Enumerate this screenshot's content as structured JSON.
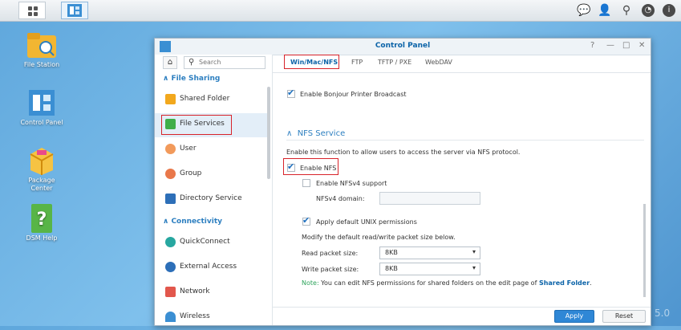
{
  "taskbar": {
    "tray_icons": [
      "chat-icon",
      "user-icon",
      "search-icon",
      "dashboard-icon",
      "info-icon"
    ]
  },
  "desktop": {
    "icons": [
      {
        "label": "File Station"
      },
      {
        "label": "Control Panel"
      },
      {
        "label": "Package\nCenter"
      },
      {
        "label": "DSM Help"
      }
    ]
  },
  "window": {
    "title": "Control Panel",
    "controls": [
      "?",
      "—",
      "□",
      "✕"
    ]
  },
  "sidebar": {
    "search_placeholder": "Search",
    "section1": "File Sharing",
    "section2": "Connectivity",
    "items": [
      {
        "label": "Shared Folder"
      },
      {
        "label": "File Services"
      },
      {
        "label": "User"
      },
      {
        "label": "Group"
      },
      {
        "label": "Directory Service"
      },
      {
        "label": "QuickConnect"
      },
      {
        "label": "External Access"
      },
      {
        "label": "Network"
      },
      {
        "label": "Wireless"
      }
    ]
  },
  "tabs": [
    "Win/Mac/NFS",
    "FTP",
    "TFTP / PXE",
    "WebDAV"
  ],
  "content": {
    "bonjour": "Enable Bonjour Printer Broadcast",
    "nfs_title": "NFS Service",
    "nfs_desc": "Enable this function to allow users to access the server via NFS protocol.",
    "enable_nfs": "Enable NFS",
    "nfsv4": "Enable NFSv4 support",
    "nfsv4_domain_label": "NFSv4 domain:",
    "nfsv4_domain_value": "",
    "unix_perm": "Apply default UNIX permissions",
    "packet_desc": "Modify the default read/write packet size below.",
    "read_label": "Read packet size:",
    "read_value": "8KB",
    "write_label": "Write packet size:",
    "write_value": "8KB",
    "note_prefix": "Note:",
    "note_text": " You can edit NFS permissions for shared folders on the edit page of ",
    "note_link": "Shared Folder",
    "note_end": "."
  },
  "buttons": {
    "apply": "Apply",
    "reset": "Reset"
  },
  "watermark": "5.0"
}
